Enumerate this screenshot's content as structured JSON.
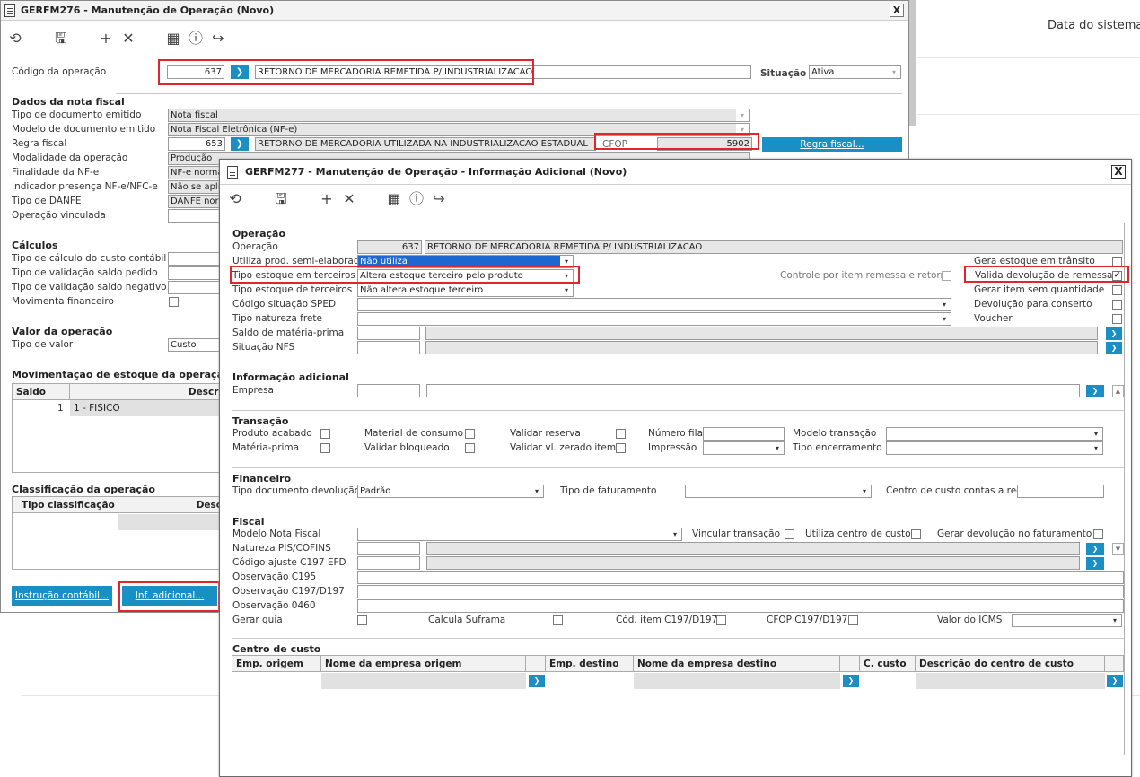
{
  "background": {
    "header_right": "Data do sistema"
  },
  "win1": {
    "title": "GERFM276 - Manutenção de Operação (Novo)",
    "close": "X",
    "codigo_label": "Código da operação",
    "codigo_value": "637",
    "codigo_desc": "RETORNO DE MERCADORIA REMETIDA P/ INDUSTRIALIZACAO",
    "situacao_label": "Situação",
    "situacao_value": "Ativa",
    "dados_title": "Dados da nota fiscal",
    "tipo_doc_label": "Tipo de documento emitido",
    "tipo_doc_value": "Nota fiscal",
    "modelo_doc_label": "Modelo de documento emitido",
    "modelo_doc_value": "Nota Fiscal Eletrônica (NF-e)",
    "regra_label": "Regra fiscal",
    "regra_value": "653",
    "regra_desc": "RETORNO DE MERCADORIA UTILIZADA NA INDUSTRIALIZACAO ESTADUAL",
    "cfop_label": "CFOP",
    "cfop_value": "5902",
    "regra_btn": "Regra fiscal...",
    "modalidade_label": "Modalidade da operação",
    "modalidade_value": "Produção",
    "finalidade_label": "Finalidade da NF-e",
    "finalidade_value": "NF-e normal",
    "indicador_label": "Indicador presença NF-e/NFC-e",
    "indicador_value": "Não se aplica",
    "danfe_label": "Tipo de DANFE",
    "danfe_value": "DANFE normal",
    "vinculada_label": "Operação vinculada",
    "calculos_title": "Cálculos",
    "custo_contabil_label": "Tipo de cálculo do custo contábil",
    "valid_pedido_label": "Tipo de validação saldo pedido",
    "valid_negativo_label": "Tipo de validação saldo negativo",
    "mov_financeiro_label": "Movimenta financeiro",
    "valor_title": "Valor da operação",
    "tipo_valor_label": "Tipo de valor",
    "tipo_valor_value": "Custo",
    "mov_estoque_title": "Movimentação de estoque da operação",
    "grid_saldo": "Saldo",
    "grid_descr": "Descri",
    "grid_row_saldo": "1",
    "grid_row_desc": "1 - FISICO",
    "classif_title": "Classificação da operação",
    "classif_col1": "Tipo classificação",
    "classif_col2": "Desc",
    "btn_instrucao": "Instrução contábil...",
    "btn_inf": "Inf. adicional..."
  },
  "win2": {
    "title": "GERFM277 - Manutenção de Operação - Informação Adicional (Novo)",
    "close": "X",
    "operacao_title": "Operação",
    "operacao_label": "Operação",
    "operacao_value": "637",
    "operacao_desc": "RETORNO DE MERCADORIA REMETIDA P/ INDUSTRIALIZACAO",
    "utiliza_label": "Utiliza prod. semi-elaborado",
    "utiliza_value": "Não utiliza",
    "tipo_estoque_em_label": "Tipo estoque em terceiros",
    "tipo_estoque_em_value": "Altera estoque terceiro pelo produto",
    "tipo_estoque_de_label": "Tipo estoque de terceiros",
    "tipo_estoque_de_value": "Não altera estoque terceiro",
    "sped_label": "Código situação SPED",
    "frete_label": "Tipo natureza frete",
    "saldo_mp_label": "Saldo de matéria-prima",
    "situacao_nfs_label": "Situação NFS",
    "gera_transito_label": "Gera estoque em trânsito",
    "controle_label": "Controle por item remessa e retorno",
    "valida_dev_label": "Valida devolução de remessa",
    "gerar_item_label": "Gerar item sem quantidade",
    "dev_conserto_label": "Devolução para conserto",
    "voucher_label": "Voucher",
    "info_title": "Informação adicional",
    "empresa_label": "Empresa",
    "transacao_title": "Transação",
    "prod_acabado_label": "Produto acabado",
    "materia_prima_label": "Matéria-prima",
    "mat_consumo_label": "Material de consumo",
    "validar_bloq_label": "Validar bloqueado",
    "validar_reserva_label": "Validar reserva",
    "validar_vl_label": "Validar vl. zerado item",
    "numero_fila_label": "Número fila",
    "impressao_label": "Impressão",
    "modelo_transacao_label": "Modelo transação",
    "tipo_encerramento_label": "Tipo encerramento",
    "financeiro_title": "Financeiro",
    "tipo_doc_dev_label": "Tipo documento devolução",
    "tipo_doc_dev_value": "Padrão",
    "tipo_fat_label": "Tipo de faturamento",
    "centro_receber_label": "Centro de custo contas a receber",
    "fiscal_title": "Fiscal",
    "modelo_nf_label": "Modelo Nota Fiscal",
    "vincular_label": "Vincular transação",
    "utiliza_centro_label": "Utiliza centro de custo",
    "gerar_dev_label": "Gerar devolução no faturamento",
    "natureza_label": "Natureza PIS/COFINS",
    "ajuste_label": "Código ajuste C197 EFD",
    "obs_c195_label": "Observação C195",
    "obs_c197_label": "Observação C197/D197",
    "obs_0460_label": "Observação 0460",
    "gerar_guia_label": "Gerar guia",
    "suframa_label": "Calcula Suframa",
    "cod_item_label": "Cód. item C197/D197",
    "cfop_c197_label": "CFOP C197/D197",
    "valor_icms_label": "Valor do ICMS",
    "centro_title": "Centro de custo",
    "col_emp_origem": "Emp. origem",
    "col_nome_origem": "Nome da empresa origem",
    "col_emp_destino": "Emp. destino",
    "col_nome_destino": "Nome da empresa destino",
    "col_c_custo": "C. custo",
    "col_desc_custo": "Descrição do centro de custo"
  },
  "icons": {
    "undo": "undo-icon",
    "save": "save-icon",
    "add": "plus-icon",
    "cancel": "x-icon",
    "calendar": "calendar-icon",
    "help": "help-icon",
    "exit": "exit-icon"
  },
  "colors": {
    "accent": "#1a8fc4",
    "highlight": "#e0262d",
    "selection": "#1e66d0"
  }
}
